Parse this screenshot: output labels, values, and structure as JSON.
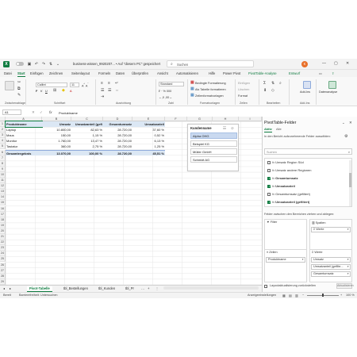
{
  "titlebar": {
    "app_icon": "X",
    "autosave_icon": "autosave-toggle-icon",
    "file_title": "business-wissen_9920207... • Auf \"diesem PC\" gespeichert",
    "search_placeholder": "Suchen",
    "avatar_initial": "K",
    "minimize": "—",
    "maximize": "▢",
    "close": "✕"
  },
  "ribbon_tabs": [
    "Datei",
    "Start",
    "Einfügen",
    "Zeichnen",
    "Seitenlayout",
    "Formeln",
    "Daten",
    "Überprüfen",
    "Ansicht",
    "Automatisieren",
    "Hilfe",
    "Power Pivot",
    "PivotTable-Analyse",
    "Entwurf"
  ],
  "active_tab": "Start",
  "ribbon": {
    "font_name": "Calibri",
    "font_size": "11",
    "number_format": "Standard",
    "bedingte": "Bedingte Formatierung",
    "als_tabelle": "Als Tabelle formatieren",
    "zellformat": "Zellenformatvorlagen",
    "einfuegen": "Einfügen",
    "loeschen": "Löschen",
    "format": "Format",
    "addins": "Add-Ins",
    "datenanalyse": "Datenanalyse",
    "groups": [
      "Zwischenablage",
      "Schriftart",
      "Ausrichtung",
      "Zahl",
      "Formatvorlagen",
      "Zellen",
      "Bearbeiten",
      "Add-Ins"
    ]
  },
  "formula_bar": {
    "name_box": "A1",
    "fx": "fx",
    "content": "Produktname"
  },
  "columns": [
    "A",
    "B",
    "C",
    "D",
    "E",
    "F",
    "G",
    "H",
    "I"
  ],
  "rows": [
    "1",
    "2",
    "3",
    "4",
    "5",
    "6",
    "7",
    "8",
    "9",
    "10",
    "11",
    "12",
    "13",
    "14",
    "15",
    "16",
    "17",
    "18",
    "19",
    "20",
    "21",
    "22",
    "23",
    "24",
    "25",
    "26",
    "27",
    "28",
    "29"
  ],
  "table": {
    "headers": [
      "Produktname",
      "Umsatz",
      "Umsatzanteil (gefi",
      "Gesamtumsatz",
      "Umsatzanteil"
    ],
    "rows": [
      [
        "Laptop",
        "10.800,00",
        "82,63 %",
        "28.720,00",
        "37,60 %"
      ],
      [
        "Maus",
        "150,00",
        "1,15 %",
        "28.720,00",
        "0,52 %"
      ],
      [
        "Monitor",
        "1.760,00",
        "13,47 %",
        "28.720,00",
        "6,13 %"
      ],
      [
        "Tastatur",
        "360,00",
        "2,75 %",
        "28.720,00",
        "1,25 %"
      ]
    ],
    "total": [
      "Gesamtergebnis",
      "13.070,00",
      "100,00 %",
      "28.720,00",
      "45,51 %"
    ]
  },
  "slicer": {
    "title": "Kundenname",
    "items": [
      "Alpha OHG",
      "Beispiel KG",
      "Müller GmbH",
      "Schmidt AG"
    ],
    "selected_index": 0
  },
  "sheet_tabs": [
    "Pivot-Tabelle",
    "tbl_Bestellungen",
    "tbl_Kunden",
    "tbl_Pr"
  ],
  "active_sheet": "Pivot-Tabelle",
  "statusbar": {
    "ready": "Bereit",
    "accessibility": "Barrierefreiheit: Untersuchen",
    "display_settings": "Anzeigeeinstellungen",
    "zoom": "100 %"
  },
  "pivot_panel": {
    "title": "PivotTable-Felder",
    "tabs": [
      "Aktiv",
      "Alle"
    ],
    "hint": "In den Bericht aufzunehmende Felder auswählen:",
    "search_placeholder": "Suchen",
    "fields": [
      {
        "label": "Umsatz Region Süd",
        "checked": false,
        "bold": false
      },
      {
        "label": "Umsatz andere Regionen",
        "checked": false,
        "bold": false
      },
      {
        "label": "Gesamtumsatz",
        "checked": true,
        "bold": true
      },
      {
        "label": "Umsatzanteil",
        "checked": true,
        "bold": true
      },
      {
        "label": "Gesamtumsatz (gefiltert)",
        "checked": false,
        "bold": false
      },
      {
        "label": "Umsatzanteil (gefiltert)",
        "checked": true,
        "bold": true
      }
    ],
    "drag_hint": "Felder zwischen den Bereichen ziehen und ablegen:",
    "areas": {
      "filter": "Filter",
      "columns": "Spalten",
      "rows": "Zeilen",
      "values": "Werte"
    },
    "columns_chips": [
      "Σ Werte"
    ],
    "rows_chips": [
      "Produktname"
    ],
    "values_chips": [
      "Umsatz",
      "Umsatzanteil (gefilte...",
      "Gesamtumsatz"
    ],
    "defer_label": "Layoutaktualisierung zurückstellen",
    "update_button": "Aktualisieren"
  }
}
